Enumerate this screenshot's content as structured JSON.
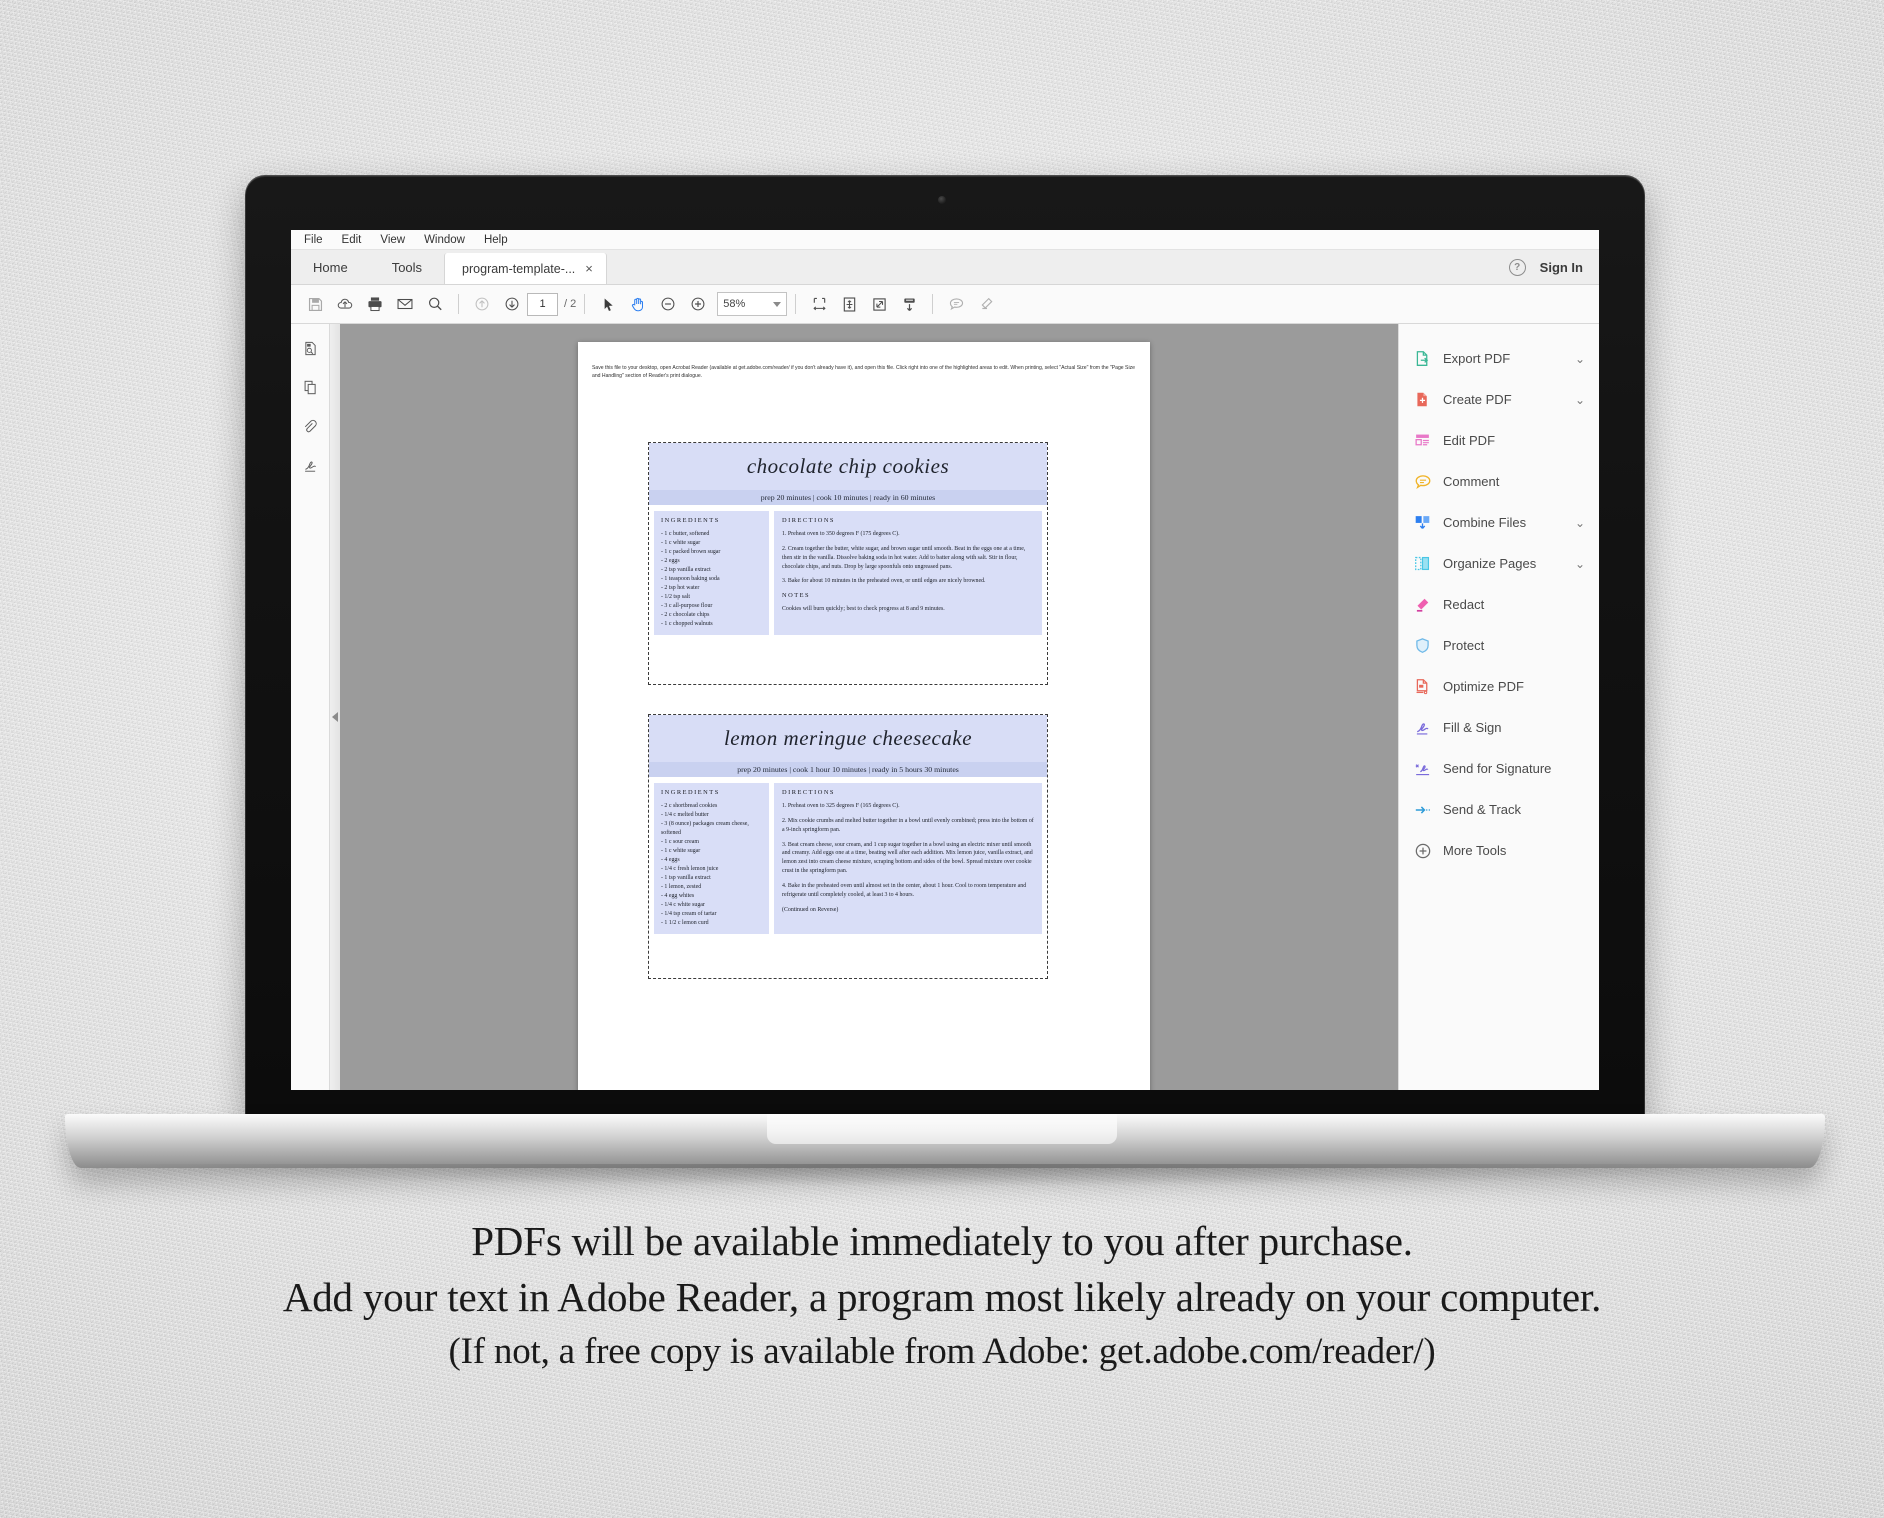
{
  "window": {
    "menu": [
      "File",
      "Edit",
      "View",
      "Window",
      "Help"
    ],
    "tabs": {
      "home": "Home",
      "tools": "Tools",
      "document": "program-template-...",
      "close": "×"
    },
    "sign_in": "Sign In",
    "help_icon": "?"
  },
  "toolbar": {
    "icons": [
      "save-icon",
      "upload-to-cloud-icon",
      "print-icon",
      "email-icon",
      "search-icon",
      "previous-page-icon",
      "next-page-icon"
    ],
    "page_current": "1",
    "page_total": "/ 2",
    "zoom_value": "58%",
    "tools": [
      "select-tool-icon",
      "hand-tool-icon",
      "zoom-out-icon",
      "zoom-in-icon",
      "fit-width-icon",
      "fit-page-icon",
      "zoom-to-selection-icon",
      "scroll-mode-icon",
      "comment-icon",
      "highlight-icon"
    ]
  },
  "left_rail": {
    "items": [
      "page-thumbnails-icon",
      "copy-pages-icon",
      "attachments-icon",
      "signatures-icon"
    ],
    "collapse": "collapse-panel-arrow"
  },
  "right_tools": {
    "items": [
      {
        "label": "Export PDF",
        "icon": "export-pdf-icon",
        "color": "#3ab795",
        "chevron": true
      },
      {
        "label": "Create PDF",
        "icon": "create-pdf-icon",
        "color": "#e8685a",
        "chevron": true
      },
      {
        "label": "Edit PDF",
        "icon": "edit-pdf-icon",
        "color": "#e878c8",
        "chevron": false
      },
      {
        "label": "Comment",
        "icon": "comment-icon",
        "color": "#f0b429",
        "chevron": false
      },
      {
        "label": "Combine Files",
        "icon": "combine-files-icon",
        "color": "#2d7ff0",
        "chevron": true
      },
      {
        "label": "Organize Pages",
        "icon": "organize-pages-icon",
        "color": "#49c6e5",
        "chevron": true
      },
      {
        "label": "Redact",
        "icon": "redact-icon",
        "color": "#ef5fb0",
        "chevron": false
      },
      {
        "label": "Protect",
        "icon": "protect-icon",
        "color": "#6fb9e8",
        "chevron": false
      },
      {
        "label": "Optimize PDF",
        "icon": "optimize-pdf-icon",
        "color": "#e8685a",
        "chevron": false
      },
      {
        "label": "Fill & Sign",
        "icon": "fill-and-sign-icon",
        "color": "#7a6bdb",
        "chevron": false
      },
      {
        "label": "Send for Signature",
        "icon": "send-for-signature-icon",
        "color": "#7a6bdb",
        "chevron": false
      },
      {
        "label": "Send & Track",
        "icon": "send-and-track-icon",
        "color": "#2d9bd8",
        "chevron": false
      },
      {
        "label": "More Tools",
        "icon": "more-tools-icon",
        "color": "#6b6b6b",
        "chevron": false
      }
    ]
  },
  "document": {
    "instructions": "Save this file to your desktop, open Acrobat Reader (available at get.adobe.com/reader/ if you don't already have it), and open this file.  Click right into one of the highlighted areas to edit. When printing, select \"Actual Size\" from the \"Page Size and Handling\" section of Reader's print dialogue.",
    "recipes": [
      {
        "title": "chocolate chip cookies",
        "meta": "prep 20 minutes | cook 10 minutes | ready in 60 minutes",
        "ingredients_heading": "INGREDIENTS",
        "ingredients": [
          "- 1 c butter, softened",
          "- 1 c white sugar",
          "- 1 c packed brown sugar",
          "- 2 eggs",
          "- 2 tsp vanilla extract",
          "- 1 teaspoon baking soda",
          "- 2 tsp hot water",
          "- 1/2 tsp salt",
          "- 3 c all-purpose flour",
          "- 2 c chocolate chips",
          "- 1 c chopped walnuts"
        ],
        "directions_heading": "DIRECTIONS",
        "directions": [
          "1.  Preheat oven to 350 degrees F (175 degrees C).",
          "2.  Cream together the butter, white sugar, and brown sugar until smooth. Beat in the eggs one at a time, then stir in the vanilla. Dissolve baking soda in hot water. Add to batter along with salt. Stir in flour, chocolate chips, and nuts. Drop by large spoonfuls onto ungreased pans.",
          "3.  Bake for about 10 minutes in the preheated oven, or until edges are nicely browned."
        ],
        "notes_heading": "NOTES",
        "notes": "Cookies will burn quickly; best to check progress at 8 and 9 minutes."
      },
      {
        "title": "lemon meringue cheesecake",
        "meta": "prep 20 minutes | cook 1 hour 10 minutes | ready in 5 hours 30 minutes",
        "ingredients_heading": "INGREDIENTS",
        "ingredients": [
          "- 2 c shortbread cookies",
          "- 1/4 c melted butter",
          "- 3 (8 ounce) packages cream cheese, softened",
          "- 1 c sour cream",
          "- 1 c white sugar",
          "- 4 eggs",
          "- 1/4 c fresh lemon juice",
          "- 1 tsp vanilla extract",
          "- 1 lemon, zested",
          "- 4 egg whites",
          "- 1/4 c white sugar",
          "- 1/4 tsp cream of tartar",
          "- 1 1/2 c lemon curd"
        ],
        "directions_heading": "DIRECTIONS",
        "directions": [
          "1.  Preheat oven to 325 degrees F (165 degrees C).",
          "2.  Mix cookie crumbs and melted butter together in a bowl until evenly combined; press into the bottom of a 9-inch springform pan.",
          "3.  Beat cream cheese, sour cream, and 1 cup sugar together in a bowl using an electric mixer until smooth and creamy. Add eggs one at a time, beating well after each addition. Mix lemon juice, vanilla extract, and lemon zest into cream cheese mixture, scraping bottom and sides of the bowl. Spread mixture over cookie crust in the springform pan.",
          "4.  Bake in the preheated oven until almost set in the center, about 1 hour. Cool to room temperature and refrigerate until completely cooled, at least 3 to 4 hours."
        ],
        "continued": "(Continued on Reverse)"
      }
    ]
  },
  "caption": {
    "line1": "PDFs will be available immediately to you after purchase.",
    "line2": "Add your text in Adobe Reader, a program most likely already on your computer.",
    "line3": "(If not, a free copy is available from Adobe: get.adobe.com/reader/)"
  }
}
